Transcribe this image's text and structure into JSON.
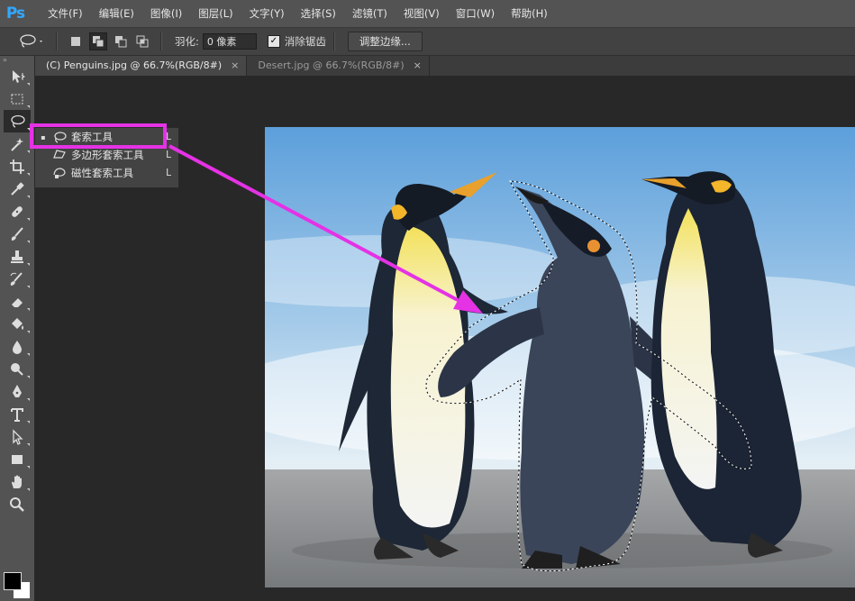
{
  "app": {
    "logo": "Ps"
  },
  "menu": [
    "文件(F)",
    "编辑(E)",
    "图像(I)",
    "图层(L)",
    "文字(Y)",
    "选择(S)",
    "滤镜(T)",
    "视图(V)",
    "窗口(W)",
    "帮助(H)"
  ],
  "options": {
    "feather_label": "羽化:",
    "feather_value": "0 像素",
    "antialias_label": "消除锯齿",
    "antialias_checked": "✓",
    "refine_edge": "调整边缘..."
  },
  "tabs": [
    {
      "label": "(C) Penguins.jpg @ 66.7%(RGB/8#)",
      "close": "×"
    },
    {
      "label": "Desert.jpg @ 66.7%(RGB/8#)",
      "close": "×"
    }
  ],
  "toolbar_header": "»",
  "tools": [
    "move-icon",
    "marquee-icon",
    "lasso-icon",
    "magic-wand-icon",
    "crop-icon",
    "eyedropper-icon",
    "healing-brush-icon",
    "brush-icon",
    "clone-stamp-icon",
    "history-brush-icon",
    "eraser-icon",
    "paint-bucket-icon",
    "blur-icon",
    "dodge-icon",
    "pen-icon",
    "type-icon",
    "path-selection-icon",
    "rectangle-icon",
    "hand-icon",
    "zoom-icon"
  ],
  "flyout": [
    {
      "label": "套索工具",
      "key": "L",
      "selected": "▪"
    },
    {
      "label": "多边形套索工具",
      "key": "L"
    },
    {
      "label": "磁性套索工具",
      "key": "L"
    }
  ],
  "colors": {
    "accent": "#e532e5",
    "ps_blue": "#31a8ff"
  }
}
